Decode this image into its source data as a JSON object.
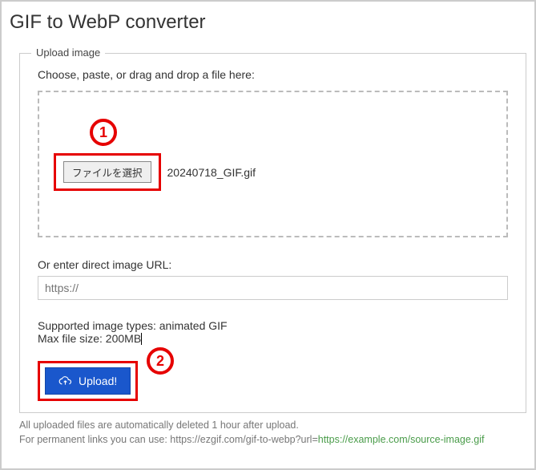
{
  "title": "GIF to WebP converter",
  "fieldset": {
    "legend": "Upload image",
    "instruction": "Choose, paste, or drag and drop a file here:",
    "file_button": "ファイルを選択",
    "filename": "20240718_GIF.gif",
    "or_label": "Or enter direct image URL:",
    "url_placeholder": "https://",
    "supported": "Supported image types: animated GIF",
    "maxsize": "Max file size: 200MB",
    "upload_label": "Upload!"
  },
  "annotations": {
    "step1": "1",
    "step2": "2"
  },
  "footer": {
    "line1": "All uploaded files are automatically deleted 1 hour after upload.",
    "line2_prefix": "For permanent links you can use: https://ezgif.com/gif-to-webp?url=",
    "line2_link": "https://example.com/source-image.gif"
  }
}
